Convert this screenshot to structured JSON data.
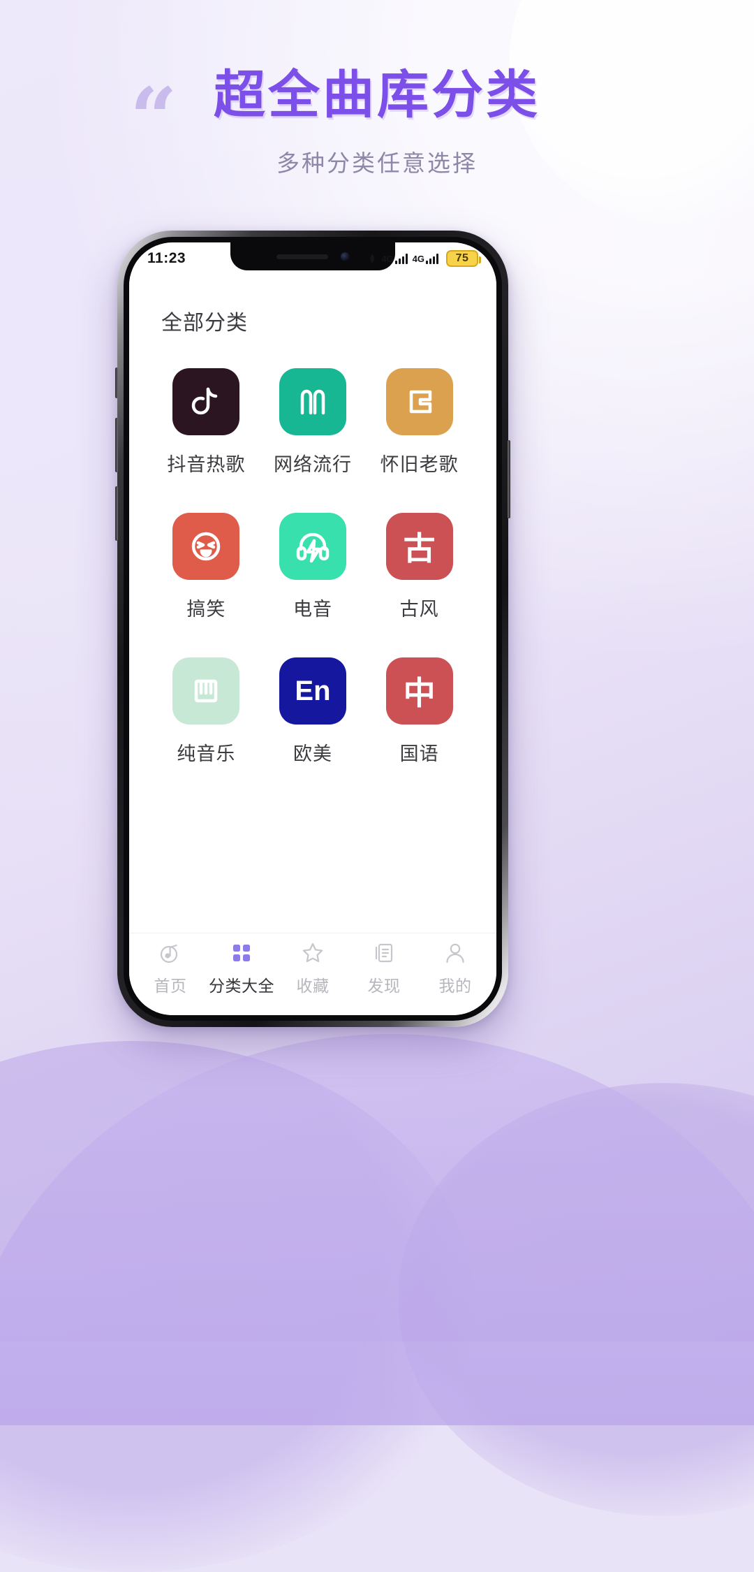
{
  "promo": {
    "quote_mark": "“",
    "title": "超全曲库分类",
    "subtitle": "多种分类任意选择",
    "title_color": "#7B4FE8",
    "subtitle_color": "#8F86A8"
  },
  "status_bar": {
    "time": "11:23",
    "signal_1_label": "4G",
    "signal_2_label": "4G",
    "battery_level": "75",
    "battery_color": "#F6D34A"
  },
  "app": {
    "page_title": "全部分类",
    "categories": [
      {
        "label": "抖音热歌",
        "icon": "tiktok-note-icon",
        "bg": "#2B1521",
        "glyph": ""
      },
      {
        "label": "网络流行",
        "icon": "letter-m-icon",
        "bg": "#17B794",
        "glyph": ""
      },
      {
        "label": "怀旧老歌",
        "icon": "letter-c-icon",
        "bg": "#DCA14F",
        "glyph": ""
      },
      {
        "label": "搞笑",
        "icon": "laughing-face-icon",
        "bg": "#E05C4A",
        "glyph": ""
      },
      {
        "label": "电音",
        "icon": "headphones-bolt-icon",
        "bg": "#38E0AE",
        "glyph": ""
      },
      {
        "label": "古风",
        "icon": "hanzi-gu-icon",
        "bg": "#CC5155",
        "glyph": "古"
      },
      {
        "label": "纯音乐",
        "icon": "piano-keys-icon",
        "bg": "#C7E8D4",
        "glyph": ""
      },
      {
        "label": "欧美",
        "icon": "letters-en-icon",
        "bg": "#15189E",
        "glyph": "En"
      },
      {
        "label": "国语",
        "icon": "hanzi-zhong-icon",
        "bg": "#CC5155",
        "glyph": "中"
      }
    ],
    "nav": [
      {
        "label": "首页",
        "icon": "music-note-icon",
        "active": false
      },
      {
        "label": "分类大全",
        "icon": "grid-icon",
        "active": true
      },
      {
        "label": "收藏",
        "icon": "star-icon",
        "active": false
      },
      {
        "label": "发现",
        "icon": "document-icon",
        "active": false
      },
      {
        "label": "我的",
        "icon": "person-icon",
        "active": false
      }
    ],
    "nav_active_color": "#8C7BE8"
  }
}
